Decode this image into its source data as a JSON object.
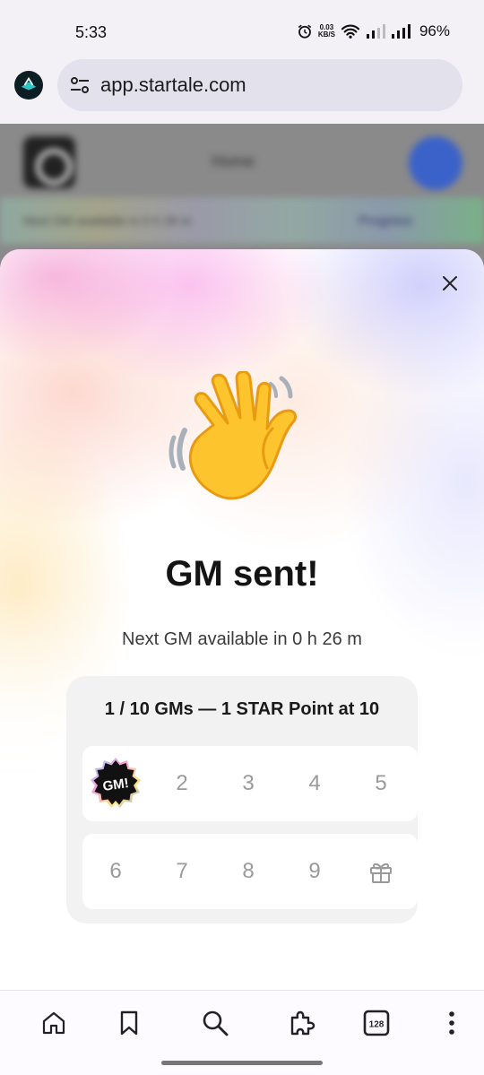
{
  "status_bar": {
    "time": "5:33",
    "net_speed_value": "0.03",
    "net_speed_unit": "KB/S",
    "battery": "96%"
  },
  "browser": {
    "url": "app.startale.com",
    "tab_count": "128"
  },
  "background_page": {
    "title": "Home",
    "strip_text": "Next GM available in 0 h 26 m",
    "strip_link": "Progress"
  },
  "sheet": {
    "title": "GM sent!",
    "subtitle": "Next GM available in 0 h 26 m",
    "progress_title": "1 / 10 GMs — 1 STAR Point at 10",
    "completed_count": 1,
    "total": 10,
    "badge_text": "GM!",
    "row1": [
      "2",
      "3",
      "4",
      "5"
    ],
    "row2": [
      "6",
      "7",
      "8",
      "9"
    ]
  },
  "icons": {
    "close": "close-icon",
    "wave": "waving-hand-icon",
    "gift": "gift-icon",
    "home": "home-icon",
    "bookmark": "bookmark-icon",
    "search": "search-icon",
    "extensions": "puzzle-icon",
    "tabs": "tabs-icon",
    "menu": "more-vert-icon"
  },
  "colors": {
    "hand": "#FDC42E",
    "badge": "#111111"
  }
}
